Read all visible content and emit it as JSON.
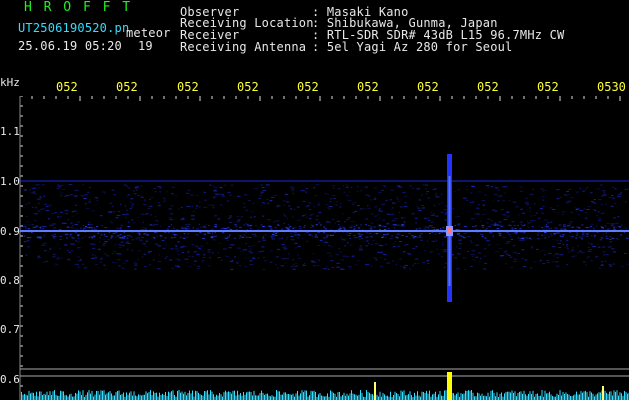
{
  "header": {
    "app_name": "H R O F F T",
    "filename": "UT2506190520.pn",
    "tag": "meteor",
    "datetime": "25.06.19 05:20",
    "count": "19",
    "info": [
      {
        "key": "Observer",
        "value": ": Masaki Kano"
      },
      {
        "key": "Receiving Location",
        "value": ": Shibukawa, Gunma, Japan"
      },
      {
        "key": "Receiver",
        "value": ": RTL-SDR SDR# 43dB L15 96.7MHz CW"
      },
      {
        "key": "Receiving Antenna",
        "value": ": 5el Yagi Az 280 for Seoul"
      }
    ]
  },
  "axis": {
    "unit": "kHz",
    "y_labels": [
      "1.1",
      "1.0",
      "0.9",
      "0.8",
      "0.7",
      "0.6"
    ],
    "time_ticks": [
      "052",
      "052",
      "052",
      "052",
      "052",
      "052",
      "052",
      "052",
      "052",
      "0530"
    ]
  },
  "colors": {
    "background": "#000000",
    "title": "#22ee22",
    "filename": "#33ddff",
    "ticks": "#ffff33",
    "signal": "#2233ff",
    "carrier": "#ffffff",
    "noise_bars": "#33ddff",
    "event_bar": "#ffff00"
  }
}
